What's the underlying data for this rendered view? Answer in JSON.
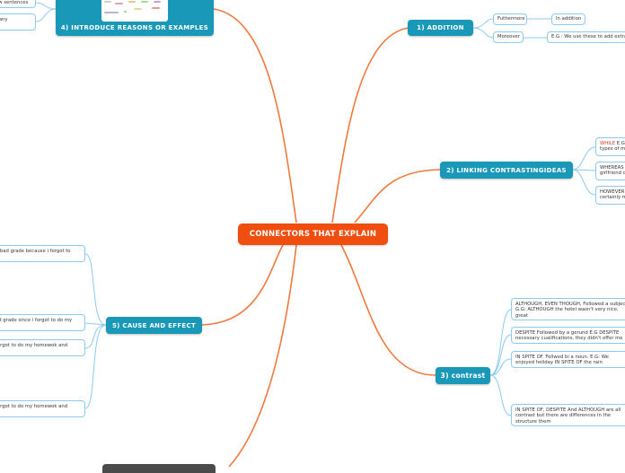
{
  "central": {
    "label": "CONNECTORS THAT EXPLAIN"
  },
  "branches": {
    "addition": {
      "label": "1)   ADDITION",
      "children": [
        {
          "label": "Futhermore",
          "children": [
            {
              "label": "In addition"
            }
          ]
        },
        {
          "label": "Moreover",
          "children": [
            {
              "label": "E.G : We use these to add extra"
            }
          ]
        }
      ]
    },
    "contrasting": {
      "label": "2)  LINKING CONTRASTINGIDEAS",
      "children": [
        {
          "highlight": "WHILE",
          "label": " E.G",
          "line2": "types of m"
        },
        {
          "label": "WHEREAS",
          "line2": "girlfriend c"
        },
        {
          "label": "HOWEVER",
          "line2": "certainly m"
        }
      ]
    },
    "contrast": {
      "label": "3)  contrast",
      "children": [
        {
          "label": "ALTHOUGH, EVEN THOUGH, Followed a subject G.G: ALTHOUGH the hotel wasn't very nice, great"
        },
        {
          "label": "DESPITE Followed by a gerund E.G DESPITE necessary cualifications, they didn't offer me"
        },
        {
          "label": "IN SPITE OF. Follwed bi a noun. E.G: We enjoyed holiday IN SPITE OF the rain"
        },
        {
          "label": "IN SPITE OF, DESPITE And  ALTHOUGH are all contrast but there are differences in the structure them"
        }
      ]
    },
    "reasons": {
      "label": "4)   INTRODUCE REASONS OR EXAMPLES",
      "children": [
        {
          "label": "ew sentences"
        },
        {
          "label": "t any"
        }
      ]
    },
    "cause": {
      "label": "5)   CAUSE AND EFFECT",
      "children": [
        {
          "label": "a bad grade because i forgot to"
        },
        {
          "label": "ad grade since i forgot to do my"
        },
        {
          "label": "forgot to do my homewok and"
        },
        {
          "label": "forgot to do my homewok and"
        }
      ]
    }
  }
}
